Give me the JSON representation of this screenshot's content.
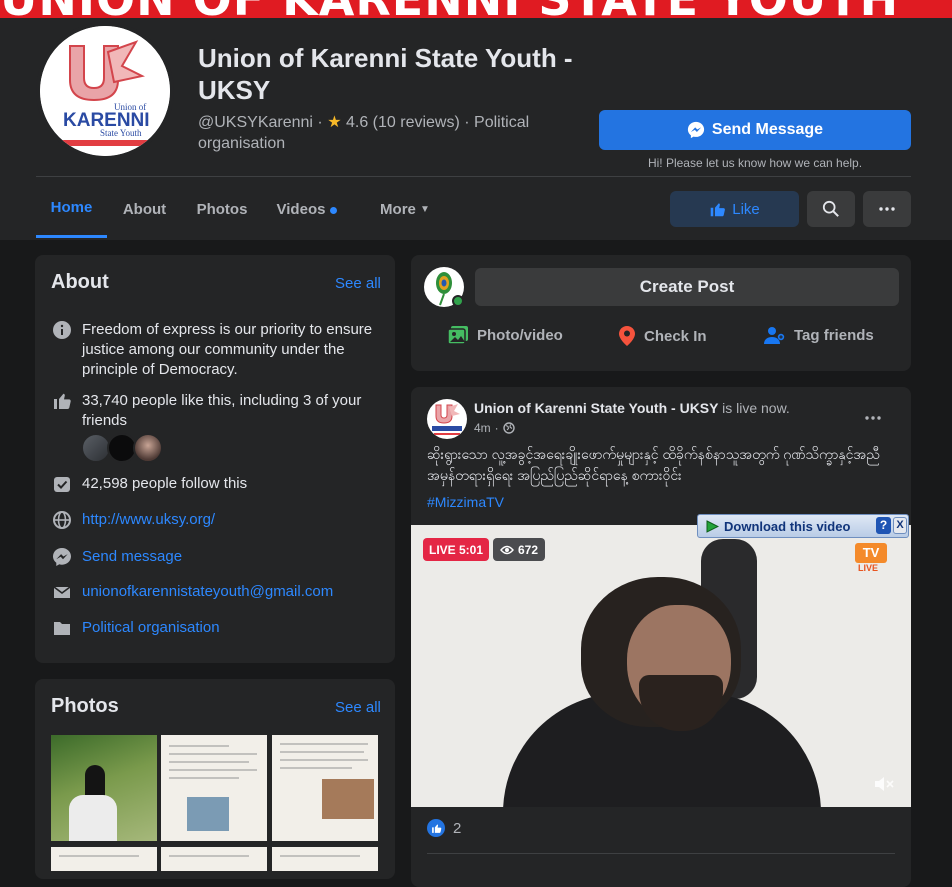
{
  "cover": {
    "text": "UNION OF KARENNI STATE YOUTH"
  },
  "page": {
    "title": "Union of Karenni State Youth - UKSY",
    "handle": "@UKSYKarenni",
    "rating": "4.6 (10 reviews)",
    "category": "Political organisation",
    "logo_text": "KARENNI",
    "logo_top": "Union of",
    "logo_sub": "State Youth"
  },
  "send_message": {
    "label": "Send Message",
    "note": "Hi! Please let us know how we can help."
  },
  "tabs": [
    {
      "label": "Home"
    },
    {
      "label": "About"
    },
    {
      "label": "Photos"
    },
    {
      "label": "Videos"
    },
    {
      "label": "More"
    }
  ],
  "actions": {
    "like": "Like"
  },
  "about": {
    "title": "About",
    "see_all": "See all",
    "description": "Freedom of express is our priority to ensure justice among our community under the principle of Democracy.",
    "likes": "33,740 people like this, including 3 of your friends",
    "follows": "42,598 people follow this",
    "website": "http://www.uksy.org/",
    "send_message": "Send message",
    "email": "unionofkarennistateyouth@gmail.com",
    "category": "Political organisation"
  },
  "photos": {
    "title": "Photos",
    "see_all": "See all"
  },
  "create_post": {
    "label": "Create Post",
    "photo_video": "Photo/video",
    "check_in": "Check In",
    "tag_friends": "Tag friends"
  },
  "post": {
    "author": "Union of Karenni State Youth - UKSY",
    "status": "is live now.",
    "time": "4m",
    "text": "ဆိုးရွားသော လူ့အခွင့်အရေးချိုးဖောက်မှုများနှင့် ထိခိုက်နစ်နာသူအတွက် ဂုဏ်သိက္ခာနှင့်အညီ အမှန်တရားရှိရေး အပြည်ပြည်ဆိုင်ရာနေ့ စကားဝိုင်း",
    "hashtag": "#MizzimaTV",
    "live_label": "LIVE 5:01",
    "viewers": "672",
    "reactions": "2",
    "channel_badge": "TV",
    "channel_live": "LIVE"
  },
  "download_bar": {
    "label": "Download this video",
    "help": "?",
    "close": "X"
  },
  "colors": {
    "accent": "#2d88ff",
    "button": "#2374e1",
    "live": "#e42645",
    "cover": "#e01b22"
  }
}
